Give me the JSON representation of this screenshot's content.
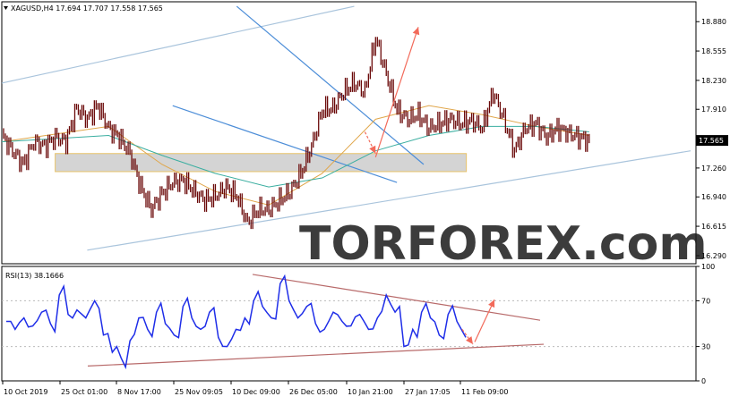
{
  "chart_data": [
    {
      "type": "candlestick",
      "legend": "XAGUSD,H4  17.694 17.707 17.558 17.565",
      "symbol": "XAGUSD",
      "timeframe": "H4",
      "ohlc": {
        "open": 17.694,
        "high": 17.707,
        "low": 17.558,
        "close": 17.565
      },
      "current_price_label": "17.565",
      "ylim": [
        16.2,
        19.1
      ],
      "yticks": [
        "18.880",
        "18.555",
        "18.230",
        "17.910",
        "17.260",
        "16.940",
        "16.615",
        "16.290"
      ],
      "close_path": [
        [
          0,
          17.62
        ],
        [
          2,
          17.45
        ],
        [
          4,
          17.3
        ],
        [
          6,
          17.55
        ],
        [
          8,
          17.5
        ],
        [
          10,
          17.6
        ],
        [
          12,
          17.55
        ],
        [
          14,
          17.92
        ],
        [
          16,
          17.8
        ],
        [
          18,
          17.95
        ],
        [
          20,
          17.7
        ],
        [
          22,
          17.6
        ],
        [
          24,
          17.42
        ],
        [
          26,
          17.05
        ],
        [
          28,
          16.8
        ],
        [
          30,
          16.98
        ],
        [
          32,
          17.1
        ],
        [
          34,
          17.12
        ],
        [
          36,
          17.0
        ],
        [
          38,
          16.9
        ],
        [
          40,
          16.95
        ],
        [
          42,
          17.05
        ],
        [
          44,
          16.95
        ],
        [
          46,
          16.65
        ],
        [
          48,
          16.8
        ],
        [
          50,
          16.8
        ],
        [
          52,
          16.9
        ],
        [
          54,
          17.0
        ],
        [
          56,
          17.2
        ],
        [
          58,
          17.5
        ],
        [
          60,
          17.9
        ],
        [
          62,
          17.92
        ],
        [
          64,
          18.1
        ],
        [
          66,
          18.2
        ],
        [
          68,
          18.1
        ],
        [
          70,
          18.7
        ],
        [
          72,
          18.3
        ],
        [
          74,
          17.9
        ],
        [
          76,
          17.8
        ],
        [
          78,
          17.85
        ],
        [
          80,
          17.7
        ],
        [
          82,
          17.75
        ],
        [
          84,
          17.8
        ],
        [
          86,
          17.75
        ],
        [
          88,
          17.78
        ],
        [
          90,
          17.7
        ],
        [
          92,
          18.1
        ],
        [
          94,
          17.8
        ],
        [
          96,
          17.45
        ],
        [
          98,
          17.7
        ],
        [
          100,
          17.75
        ],
        [
          102,
          17.6
        ],
        [
          104,
          17.7
        ],
        [
          106,
          17.65
        ],
        [
          108,
          17.6
        ],
        [
          110,
          17.565
        ]
      ],
      "moving_averages": [
        {
          "color": "#e0a64a",
          "path": [
            [
              0,
              17.55
            ],
            [
              20,
              17.72
            ],
            [
              30,
              17.3
            ],
            [
              40,
              17.0
            ],
            [
              50,
              16.85
            ],
            [
              60,
              17.2
            ],
            [
              70,
              17.8
            ],
            [
              80,
              17.95
            ],
            [
              90,
              17.85
            ],
            [
              100,
              17.72
            ],
            [
              110,
              17.62
            ]
          ]
        },
        {
          "color": "#3aaea0",
          "path": [
            [
              0,
              17.55
            ],
            [
              20,
              17.62
            ],
            [
              30,
              17.4
            ],
            [
              40,
              17.2
            ],
            [
              50,
              17.05
            ],
            [
              60,
              17.15
            ],
            [
              70,
              17.45
            ],
            [
              80,
              17.62
            ],
            [
              90,
              17.72
            ],
            [
              100,
              17.72
            ],
            [
              110,
              17.66
            ]
          ]
        }
      ],
      "channel_lines": [
        {
          "color": "#a9c4dc",
          "from": [
            0,
            18.2
          ],
          "to": [
            66,
            19.05
          ]
        },
        {
          "color": "#a9c4dc",
          "from": [
            16,
            16.35
          ],
          "to": [
            129,
            17.45
          ]
        },
        {
          "color": "#4d8ed8",
          "from": [
            44,
            19.05
          ],
          "to": [
            79,
            17.3
          ]
        },
        {
          "color": "#4d8ed8",
          "from": [
            32,
            17.95
          ],
          "to": [
            74,
            17.1
          ]
        }
      ],
      "support_zone": {
        "from": [
          10,
          17.42
        ],
        "to": [
          87,
          17.22
        ]
      },
      "arrows": [
        {
          "from": [
            68,
            17.66
          ],
          "to": [
            70,
            17.42
          ]
        },
        {
          "from": [
            70,
            17.38
          ],
          "to": [
            78,
            18.82
          ]
        }
      ],
      "watermark": "TORFOREX.com"
    },
    {
      "type": "line",
      "title": "RSI(13) 38.1666",
      "ylim": [
        0,
        100
      ],
      "yticks": [
        "100",
        "70",
        "30",
        "0"
      ],
      "series": [
        {
          "values": [
            52,
            45,
            55,
            48,
            60,
            50,
            75,
            58,
            62,
            55,
            70,
            40,
            25,
            20,
            35,
            55,
            45,
            60,
            50,
            40,
            65,
            55,
            45,
            60,
            38,
            30,
            45,
            55,
            70,
            65,
            55,
            85,
            70,
            55,
            65,
            50,
            45,
            60,
            52,
            48,
            58,
            45,
            55,
            75,
            60,
            30,
            45,
            60,
            55,
            40,
            58,
            52,
            38
          ]
        }
      ],
      "trendlines": [
        {
          "color": "#b86a6a",
          "from": [
            0,
            93
          ],
          "to": [
            1,
            53
          ]
        },
        {
          "color": "#b86a6a",
          "from": [
            0,
            13
          ],
          "to": [
            1,
            32
          ]
        }
      ],
      "arrows": [
        {
          "from": [
            0.97,
            45
          ],
          "to": [
            1.0,
            32
          ]
        },
        {
          "from": [
            1.0,
            34
          ],
          "to": [
            1.05,
            71
          ]
        }
      ],
      "x_ticks": [
        "10 Oct 2019",
        "25 Oct 01:00",
        "8 Nov 17:00",
        "25 Nov 09:05",
        "10 Dec 09:00",
        "26 Dec 05:00",
        "10 Jan 21:00",
        "27 Jan 17:05",
        "11 Feb 09:00"
      ]
    }
  ]
}
